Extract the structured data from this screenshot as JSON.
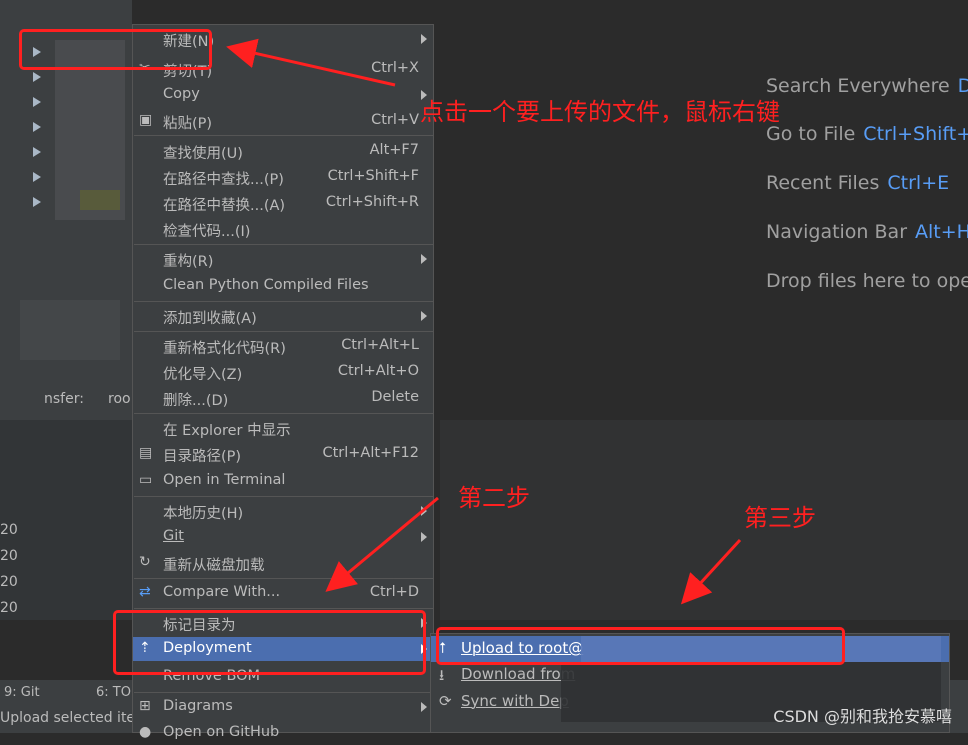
{
  "welcome": {
    "items": [
      {
        "label": "Search Everywhere",
        "key": "D"
      },
      {
        "label": "Go to File",
        "key": "Ctrl+Shift+"
      },
      {
        "label": "Recent Files",
        "key": "Ctrl+E"
      },
      {
        "label": "Navigation Bar",
        "key": "Alt+H"
      },
      {
        "label": "Drop files here to ope",
        "key": ""
      }
    ]
  },
  "context_menu": {
    "items": [
      {
        "label": "新建(N)",
        "shortcut": "",
        "submenu": true
      },
      {
        "label": "剪切(T)",
        "shortcut": "Ctrl+X",
        "icon": "scissors-icon"
      },
      {
        "label": "Copy",
        "shortcut": "",
        "submenu": true
      },
      {
        "label": "粘贴(P)",
        "shortcut": "Ctrl+V",
        "icon": "clipboard-icon"
      },
      {
        "label": "查找使用(U)",
        "shortcut": "Alt+F7"
      },
      {
        "label": "在路径中查找...(P)",
        "shortcut": "Ctrl+Shift+F"
      },
      {
        "label": "在路径中替换...(A)",
        "shortcut": "Ctrl+Shift+R"
      },
      {
        "label": "检查代码...(I)",
        "shortcut": ""
      },
      {
        "label": "重构(R)",
        "shortcut": "",
        "submenu": true
      },
      {
        "label": "Clean Python Compiled Files",
        "shortcut": ""
      },
      {
        "label": "添加到收藏(A)",
        "shortcut": "",
        "submenu": true
      },
      {
        "label": "重新格式化代码(R)",
        "shortcut": "Ctrl+Alt+L"
      },
      {
        "label": "优化导入(Z)",
        "shortcut": "Ctrl+Alt+O"
      },
      {
        "label": "删除...(D)",
        "shortcut": "Delete"
      },
      {
        "label": "在 Explorer 中显示",
        "shortcut": ""
      },
      {
        "label": "目录路径(P)",
        "shortcut": "Ctrl+Alt+F12",
        "icon": "directory-icon"
      },
      {
        "label": "Open in Terminal",
        "shortcut": "",
        "icon": "terminal-icon"
      },
      {
        "label": "本地历史(H)",
        "shortcut": "",
        "submenu": true
      },
      {
        "label": "Git",
        "shortcut": "",
        "submenu": true
      },
      {
        "label": "重新从磁盘加载",
        "shortcut": "",
        "icon": "reload-icon"
      },
      {
        "label": "Compare With...",
        "shortcut": "Ctrl+D",
        "icon": "compare-icon"
      },
      {
        "label": "标记目录为",
        "shortcut": "",
        "submenu": true
      },
      {
        "label": "Deployment",
        "shortcut": "",
        "submenu": true,
        "icon": "deployment-icon"
      },
      {
        "label": "Remove BOM",
        "shortcut": ""
      },
      {
        "label": "Diagrams",
        "shortcut": "",
        "submenu": true,
        "icon": "diagrams-icon"
      },
      {
        "label": "Open on GitHub",
        "shortcut": "",
        "icon": "github-icon"
      }
    ]
  },
  "deployment_submenu": {
    "items": [
      {
        "label": "Upload to root@",
        "icon": "upload-icon"
      },
      {
        "label": "Download from",
        "icon": "download-icon"
      },
      {
        "label": "Sync with Dep",
        "icon": "sync-icon"
      }
    ]
  },
  "annotations": {
    "step1": "点击一个要上传的文件，鼠标右键",
    "step2": "第二步",
    "step3": "第三步"
  },
  "console": {
    "line1": "nsfer:",
    "line1b": "roo",
    "num_prefix": "20"
  },
  "status": {
    "git_tab": "9: Git",
    "todo_tab": "6: TO",
    "message": "Upload selected ite"
  },
  "watermark": "CSDN @别和我抢安慕嘻",
  "colors": {
    "accent_red": "#ff2020",
    "selection": "#4b6eaf",
    "link_blue": "#589df6"
  }
}
